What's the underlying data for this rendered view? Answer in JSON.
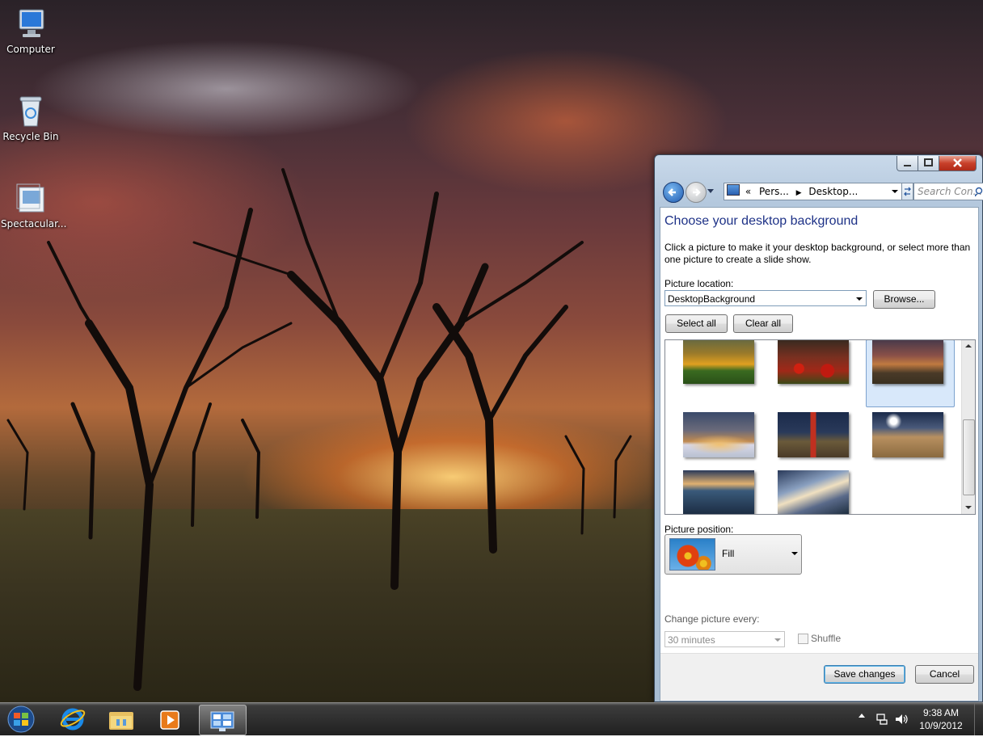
{
  "desktop": {
    "icons": [
      {
        "label": "Computer"
      },
      {
        "label": "Recycle Bin"
      },
      {
        "label": "Spectacular..."
      }
    ]
  },
  "window": {
    "address": {
      "chevrons": "«",
      "crumb1": "Pers...",
      "crumb2": "Desktop..."
    },
    "search": {
      "placeholder": "Search Con..."
    },
    "heading": "Choose your desktop background",
    "description": "Click a picture to make it your desktop background, or select more than one picture to create a slide show.",
    "picture_location": {
      "label": "Picture location:",
      "value": "DesktopBackground",
      "browse": "Browse..."
    },
    "select_all": "Select all",
    "clear_all": "Clear all",
    "thumbnails": [
      {
        "name": "sunflowers",
        "selected": false
      },
      {
        "name": "red-poppies",
        "selected": false
      },
      {
        "name": "sunset-trees",
        "selected": true
      },
      {
        "name": "tree-at-sunset",
        "selected": false
      },
      {
        "name": "lighthouse",
        "selected": false
      },
      {
        "name": "sandy-road",
        "selected": false
      },
      {
        "name": "lake-evening",
        "selected": false
      },
      {
        "name": "cloud-sky",
        "selected": false
      }
    ],
    "picture_position": {
      "label": "Picture position:",
      "value": "Fill"
    },
    "change_picture": {
      "label": "Change picture every:",
      "value": "30 minutes"
    },
    "shuffle": {
      "label": "Shuffle",
      "checked": false
    },
    "save": "Save changes",
    "cancel": "Cancel"
  },
  "taskbar": {
    "items": [
      "start-orb",
      "internet-explorer",
      "file-explorer",
      "media-player",
      "personalization"
    ],
    "clock": {
      "time": "9:38 AM",
      "date": "10/9/2012"
    }
  }
}
